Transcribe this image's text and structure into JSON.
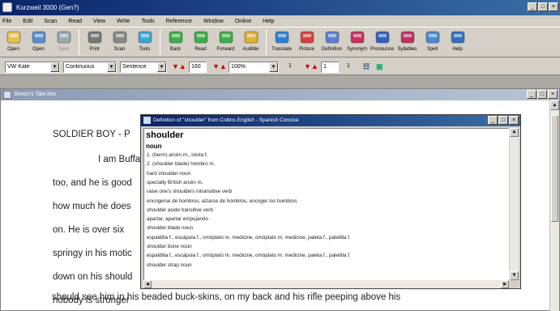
{
  "app": {
    "title": "Kurzweil 3000 (Gen?)"
  },
  "menu": [
    "File",
    "Edit",
    "Scan",
    "Read",
    "View",
    "Write",
    "Tools",
    "Reference",
    "Window",
    "Online",
    "Help"
  ],
  "toolbar": [
    {
      "label": "Open",
      "icon": "open-icon",
      "disabled": false
    },
    {
      "label": "Open",
      "icon": "scan-icon",
      "disabled": false
    },
    {
      "label": "Save",
      "icon": "save-icon",
      "disabled": true
    },
    {
      "label": "Print",
      "icon": "print-icon",
      "disabled": false
    },
    {
      "label": "Scan",
      "icon": "scan-icon",
      "disabled": false
    },
    {
      "label": "Tools",
      "icon": "tools-icon",
      "disabled": false
    },
    {
      "label": "Back",
      "icon": "back-arrow-icon",
      "disabled": false
    },
    {
      "label": "Read",
      "icon": "read-icon",
      "disabled": false
    },
    {
      "label": "Forward",
      "icon": "forward-icon",
      "disabled": false
    },
    {
      "label": "Audible",
      "icon": "audible-icon",
      "disabled": false
    },
    {
      "label": "Translate",
      "icon": "translate-icon",
      "disabled": false
    },
    {
      "label": "Picture",
      "icon": "picture-icon",
      "disabled": false
    },
    {
      "label": "Definition",
      "icon": "definition-icon",
      "disabled": false
    },
    {
      "label": "Synonym",
      "icon": "synonym-icon",
      "disabled": false
    },
    {
      "label": "Pronounce",
      "icon": "pronounce-icon",
      "disabled": false
    },
    {
      "label": "Syllables",
      "icon": "syllables-icon",
      "disabled": false
    },
    {
      "label": "Spell",
      "icon": "spell-icon",
      "disabled": false
    },
    {
      "label": "Help",
      "icon": "help-icon",
      "disabled": false
    }
  ],
  "formatbar": {
    "voice": "VW Kate",
    "voice2": "Continuous",
    "mode": "Sentence",
    "speed": "160",
    "zoom": "100%",
    "size": "1",
    "val2": "1"
  },
  "doc": {
    "title": "Simon's Tale.kes",
    "lines": [
      "SOLDIER BOY - P",
      "I am Buffalo",
      "too, and he is good",
      "how much he does",
      "on.  He is over six",
      "springy in his motic",
      "down on his should",
      "nobody is stronger",
      "should see him in his beaded buck-skins, on my back and his rifle peeping above his"
    ]
  },
  "dict": {
    "title": "Definition of \"shoulder\" from Collins English - Spanish Concise",
    "headword": "shoulder",
    "pos": "noun",
    "lines": [
      "1. (berm) arcén m., islota f.",
      "2. (shoulder blade) hombro m.",
      "hard shoulder noun",
      "specially British arcén m.",
      "raise one's shoulders intransitive verb",
      "encogerse de hombros, alzarse de hombros, encoger los hombros",
      "shoulder aside transitive verb",
      "apartar, apartar empujando",
      "shoulder blade noun",
      "espaldilla f., escápula f., omóplato m. medicine, omóplato m. medicine, paleta f., paletilla f.",
      "shoulder bone noun",
      "espaldilla f., escápula f., omóplato m. medicine, omóplato m. medicine, paleta f., paletilla f.",
      "shoulder strap noun"
    ]
  }
}
